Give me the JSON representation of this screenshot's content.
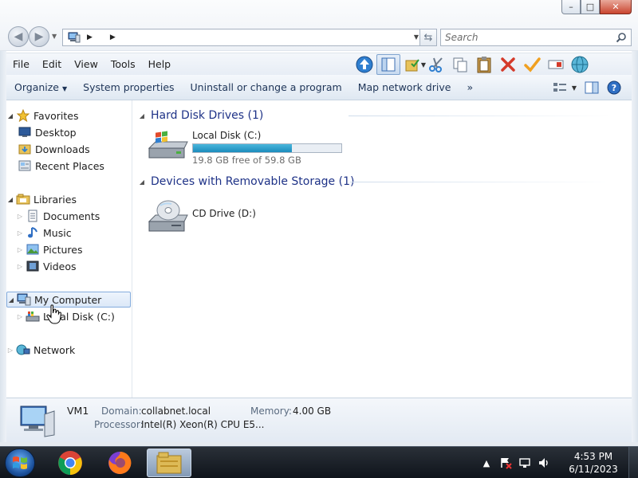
{
  "window": {
    "search_placeholder": "Search",
    "caption": {
      "minimize": "–",
      "maximize": "□",
      "close": "✕"
    }
  },
  "menu": [
    "File",
    "Edit",
    "View",
    "Tools",
    "Help"
  ],
  "commands": {
    "organize": "Organize",
    "system_properties": "System properties",
    "uninstall": "Uninstall or change a program",
    "map_drive": "Map network drive",
    "more": "»"
  },
  "nav": {
    "favorites": "Favorites",
    "desktop": "Desktop",
    "downloads": "Downloads",
    "recent_places": "Recent Places",
    "libraries": "Libraries",
    "documents": "Documents",
    "music": "Music",
    "pictures": "Pictures",
    "videos": "Videos",
    "my_computer": "My Computer",
    "local_disk": "Local Disk (C:)",
    "network": "Network"
  },
  "content": {
    "hdd_group": "Hard Disk Drives (1)",
    "removable_group": "Devices with Removable Storage (1)",
    "local_disk_name": "Local Disk (C:)",
    "local_disk_free": "19.8 GB free of 59.8 GB",
    "local_disk_used_fraction": 0.669,
    "cd_drive_name": "CD Drive (D:)"
  },
  "details": {
    "name": "VM1",
    "domain_label": "Domain:",
    "domain_value": "collabnet.local",
    "memory_label": "Memory:",
    "memory_value": "4.00 GB",
    "processor_label": "Processor:",
    "processor_value": "Intel(R) Xeon(R) CPU E5..."
  },
  "taskbar": {
    "time": "4:53 PM",
    "date": "6/11/2023"
  },
  "colors": {
    "accent": "#1e3287",
    "capacity_bar": "#1b8cbc",
    "selection": "#dbe8f8"
  }
}
